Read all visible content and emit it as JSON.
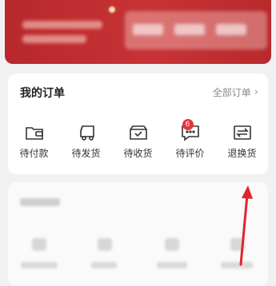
{
  "orders": {
    "title": "我的订单",
    "all_orders_label": "全部订单",
    "items": [
      {
        "label": "待付款",
        "icon": "wallet-icon"
      },
      {
        "label": "待发货",
        "icon": "truck-icon"
      },
      {
        "label": "待收货",
        "icon": "box-check-icon"
      },
      {
        "label": "待评价",
        "icon": "comment-icon",
        "badge": "6"
      },
      {
        "label": "退换货",
        "icon": "exchange-icon"
      }
    ]
  },
  "colors": {
    "banner_red": "#c73336",
    "badge_red": "#e5373b",
    "arrow_red": "#e0262b"
  }
}
